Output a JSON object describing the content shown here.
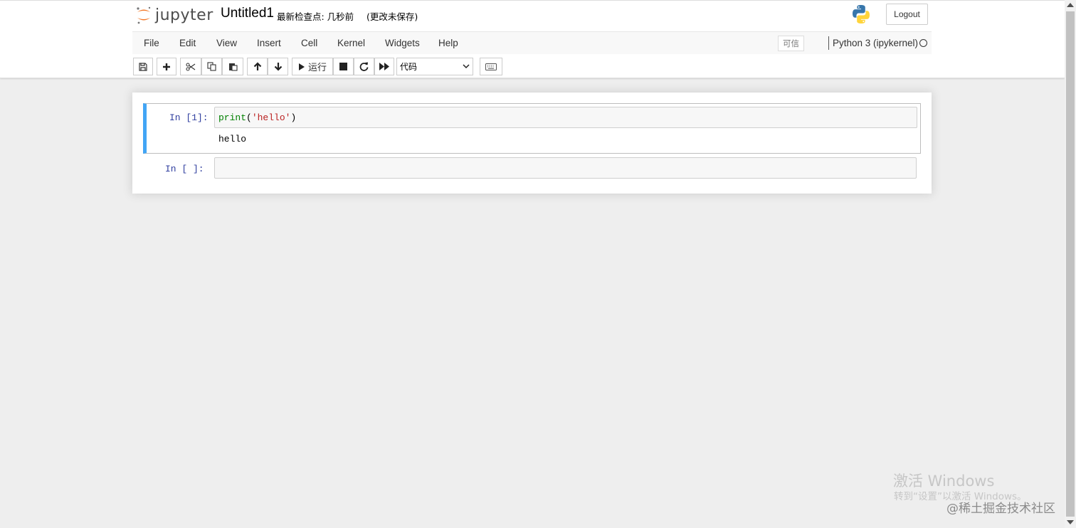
{
  "header": {
    "logo_text": "jupyter",
    "notebook_name": "Untitled1",
    "checkpoint": "最新检查点: 几秒前",
    "autosave_status": "(更改未保存)",
    "logout_label": "Logout"
  },
  "menubar": {
    "items": [
      {
        "label": "File"
      },
      {
        "label": "Edit"
      },
      {
        "label": "View"
      },
      {
        "label": "Insert"
      },
      {
        "label": "Cell"
      },
      {
        "label": "Kernel"
      },
      {
        "label": "Widgets"
      },
      {
        "label": "Help"
      }
    ],
    "trusted_label": "可信",
    "kernel_name": "Python 3 (ipykernel)"
  },
  "toolbar": {
    "buttons": [
      "save-icon",
      "plus-icon",
      "cut-icon",
      "copy-icon",
      "paste-icon",
      "arrow-up-icon",
      "arrow-down-icon",
      "play-icon",
      "stop-icon",
      "restart-icon",
      "fast-forward-icon",
      "keyboard-icon"
    ],
    "run_label": "运行",
    "cell_type": "代码"
  },
  "cells": [
    {
      "prompt": "In [1]:",
      "code_func": "print",
      "code_open": "(",
      "code_string": "'hello'",
      "code_close": ")",
      "output": "hello"
    },
    {
      "prompt": "In [ ]:",
      "code": ""
    }
  ],
  "colors": {
    "selected_cell_border": "#42a5f5",
    "prompt_color": "#303f9f",
    "keyword_color": "#008000",
    "string_color": "#ba2121"
  },
  "watermark": {
    "title": "激活 Windows",
    "subtitle": "转到“设置”以激活 Windows。",
    "site": "@稀土掘金技术社区"
  }
}
